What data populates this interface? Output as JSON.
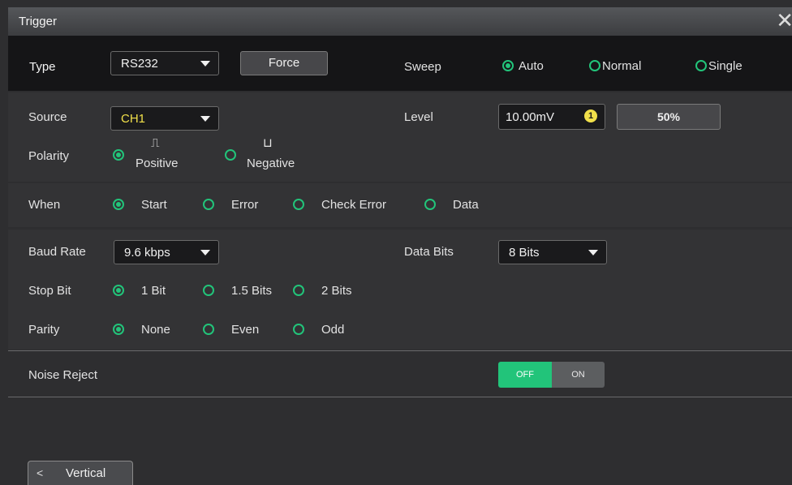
{
  "dialog": {
    "title": "Trigger"
  },
  "row_type": {
    "type_label": "Type",
    "type_value": "RS232",
    "force_label": "Force",
    "sweep_label": "Sweep",
    "sweep_options": [
      "Auto",
      "Normal",
      "Single"
    ],
    "sweep_selected": "Auto"
  },
  "source": {
    "label": "Source",
    "value": "CH1",
    "value_color": "#f1e04a",
    "level_label": "Level",
    "level_value": "10.00mV",
    "level_badge": "1",
    "fifty_label": "50%"
  },
  "polarity": {
    "label": "Polarity",
    "options": [
      "Positive",
      "Negative"
    ],
    "selected": "Positive",
    "positive_glyph": "⎍",
    "negative_glyph": "⊔"
  },
  "when": {
    "label": "When",
    "options": [
      "Start",
      "Error",
      "Check Error",
      "Data"
    ],
    "selected": "Start"
  },
  "baud": {
    "label": "Baud Rate",
    "value": "9.6 kbps"
  },
  "data_bits": {
    "label": "Data Bits",
    "value": "8 Bits"
  },
  "stop_bit": {
    "label": "Stop Bit",
    "options": [
      "1 Bit",
      "1.5 Bits",
      "2 Bits"
    ],
    "selected": "1 Bit"
  },
  "parity": {
    "label": "Parity",
    "options": [
      "None",
      "Even",
      "Odd"
    ],
    "selected": "None"
  },
  "noise_reject": {
    "label": "Noise Reject",
    "off_label": "OFF",
    "on_label": "ON",
    "state": "OFF"
  },
  "footer": {
    "vertical_label": "Vertical"
  },
  "colors": {
    "accent": "#22c47a",
    "channel": "#f1e04a"
  }
}
